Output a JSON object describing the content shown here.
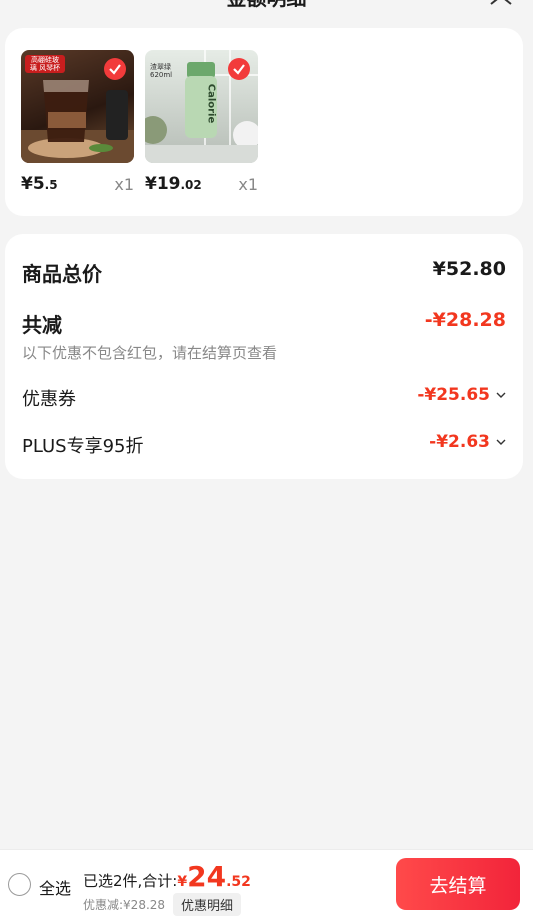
{
  "header": {
    "title": "金额明细",
    "close_icon": "close-icon"
  },
  "products": [
    {
      "price_int": "¥5",
      "price_frac": ".5",
      "qty": "x1",
      "badge": "高硼硅玻璃 风琴杯",
      "colors": [
        "#3a2418",
        "#8a5a3a"
      ]
    },
    {
      "price_int": "¥19",
      "price_frac": ".02",
      "qty": "x1",
      "badge": "渣翠绿 620ml",
      "bottle_text": "Calorie",
      "colors": [
        "#cfe3cf",
        "#9cc39c"
      ]
    }
  ],
  "summary": {
    "total_label": "商品总价",
    "total_value": "¥52.80",
    "reduce_label": "共减",
    "reduce_value": "-¥28.28",
    "note": "以下优惠不包含红包，请在结算页查看",
    "coupon_label": "优惠券",
    "coupon_value": "-¥25.65",
    "plus_label": "PLUS专享95折",
    "plus_value": "-¥2.63"
  },
  "bottom": {
    "select_all": "全选",
    "selected_text": "已选2件,合计:",
    "total_symbol": "¥",
    "total_int": "24",
    "total_frac": ".52",
    "discount_text": "优惠减:¥28.28",
    "discount_detail": "优惠明细",
    "checkout": "去结算"
  },
  "colors": {
    "accent": "#f2371f",
    "button": "#f2243a"
  }
}
